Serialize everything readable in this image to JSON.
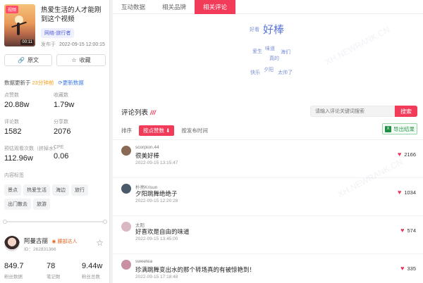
{
  "video": {
    "badge": "视频",
    "duration": "00:11",
    "title": "热爱生活的人才能刚到这个视频",
    "category": "网络-旅行者",
    "date_label": "发布于",
    "date": "2022-09-15 12:00:15"
  },
  "actions": {
    "source": "原文",
    "favorite": "收藏"
  },
  "update": {
    "label": "数据更新于",
    "time": "23分钟前",
    "refresh": "更新数据"
  },
  "stats": [
    {
      "k": "点赞数",
      "v": "20.88w"
    },
    {
      "k": "收藏数",
      "v": "1.79w"
    },
    {
      "k": "评论数",
      "v": "1582"
    },
    {
      "k": "分享数",
      "v": "2076"
    },
    {
      "k": "预估观看次数（挤掉水）",
      "v": "112.96w"
    },
    {
      "k": "CPE",
      "v": "0.06"
    }
  ],
  "content_tags": {
    "title": "内容标签",
    "items": [
      "景点",
      "热爱生活",
      "海边",
      "旅行",
      "出门散去",
      "旅游"
    ]
  },
  "author": {
    "name": "阿曼古丽",
    "badge": "腰部达人",
    "id": "ID：262831366"
  },
  "bottom_stats": [
    {
      "v": "849.7",
      "k": "粉丝数据"
    },
    {
      "v": "78",
      "k": "笔记数"
    },
    {
      "v": "9.44w",
      "k": "粉丝总数"
    }
  ],
  "tabs": [
    "互动数据",
    "相关品牌",
    "相关评论"
  ],
  "word_cloud": [
    "好看",
    "好棒",
    "爱生",
    "味道",
    "海们",
    "真的",
    "夕阳",
    "快乐",
    "太帅了"
  ],
  "comment_list": {
    "title": "评论列表",
    "search_placeholder": "请输入评论关键词搜索",
    "search_button": "搜索",
    "sort_label": "排序",
    "sort_likes": "按点赞数",
    "sort_time": "按发布时间",
    "export": "导出结果"
  },
  "comments": [
    {
      "user": "scorpion.44",
      "text": "很美好棒",
      "date": "2022-09-15 13:15:47",
      "likes": "2166",
      "avatar_color": "#8a6a55"
    },
    {
      "user": "朴亮Krisun",
      "text": "夕阳跳舞绝绝子",
      "date": "2022-09-15 12:20:28",
      "likes": "1034",
      "avatar_color": "#4a5a6a"
    },
    {
      "user": "太阳",
      "text": "好喜欢是自由的味道",
      "date": "2022-09-15 13:45:00",
      "likes": "574",
      "avatar_color": "#d9b8c4"
    },
    {
      "user": "sweetea",
      "text": "珍满跳舞变出水的那个转场真的有被惊艳到！",
      "date": "2022-09-15 17:18:48",
      "likes": "335",
      "avatar_color": "#c98fa5"
    }
  ],
  "watermark": "XH.NEWRANK.CN"
}
